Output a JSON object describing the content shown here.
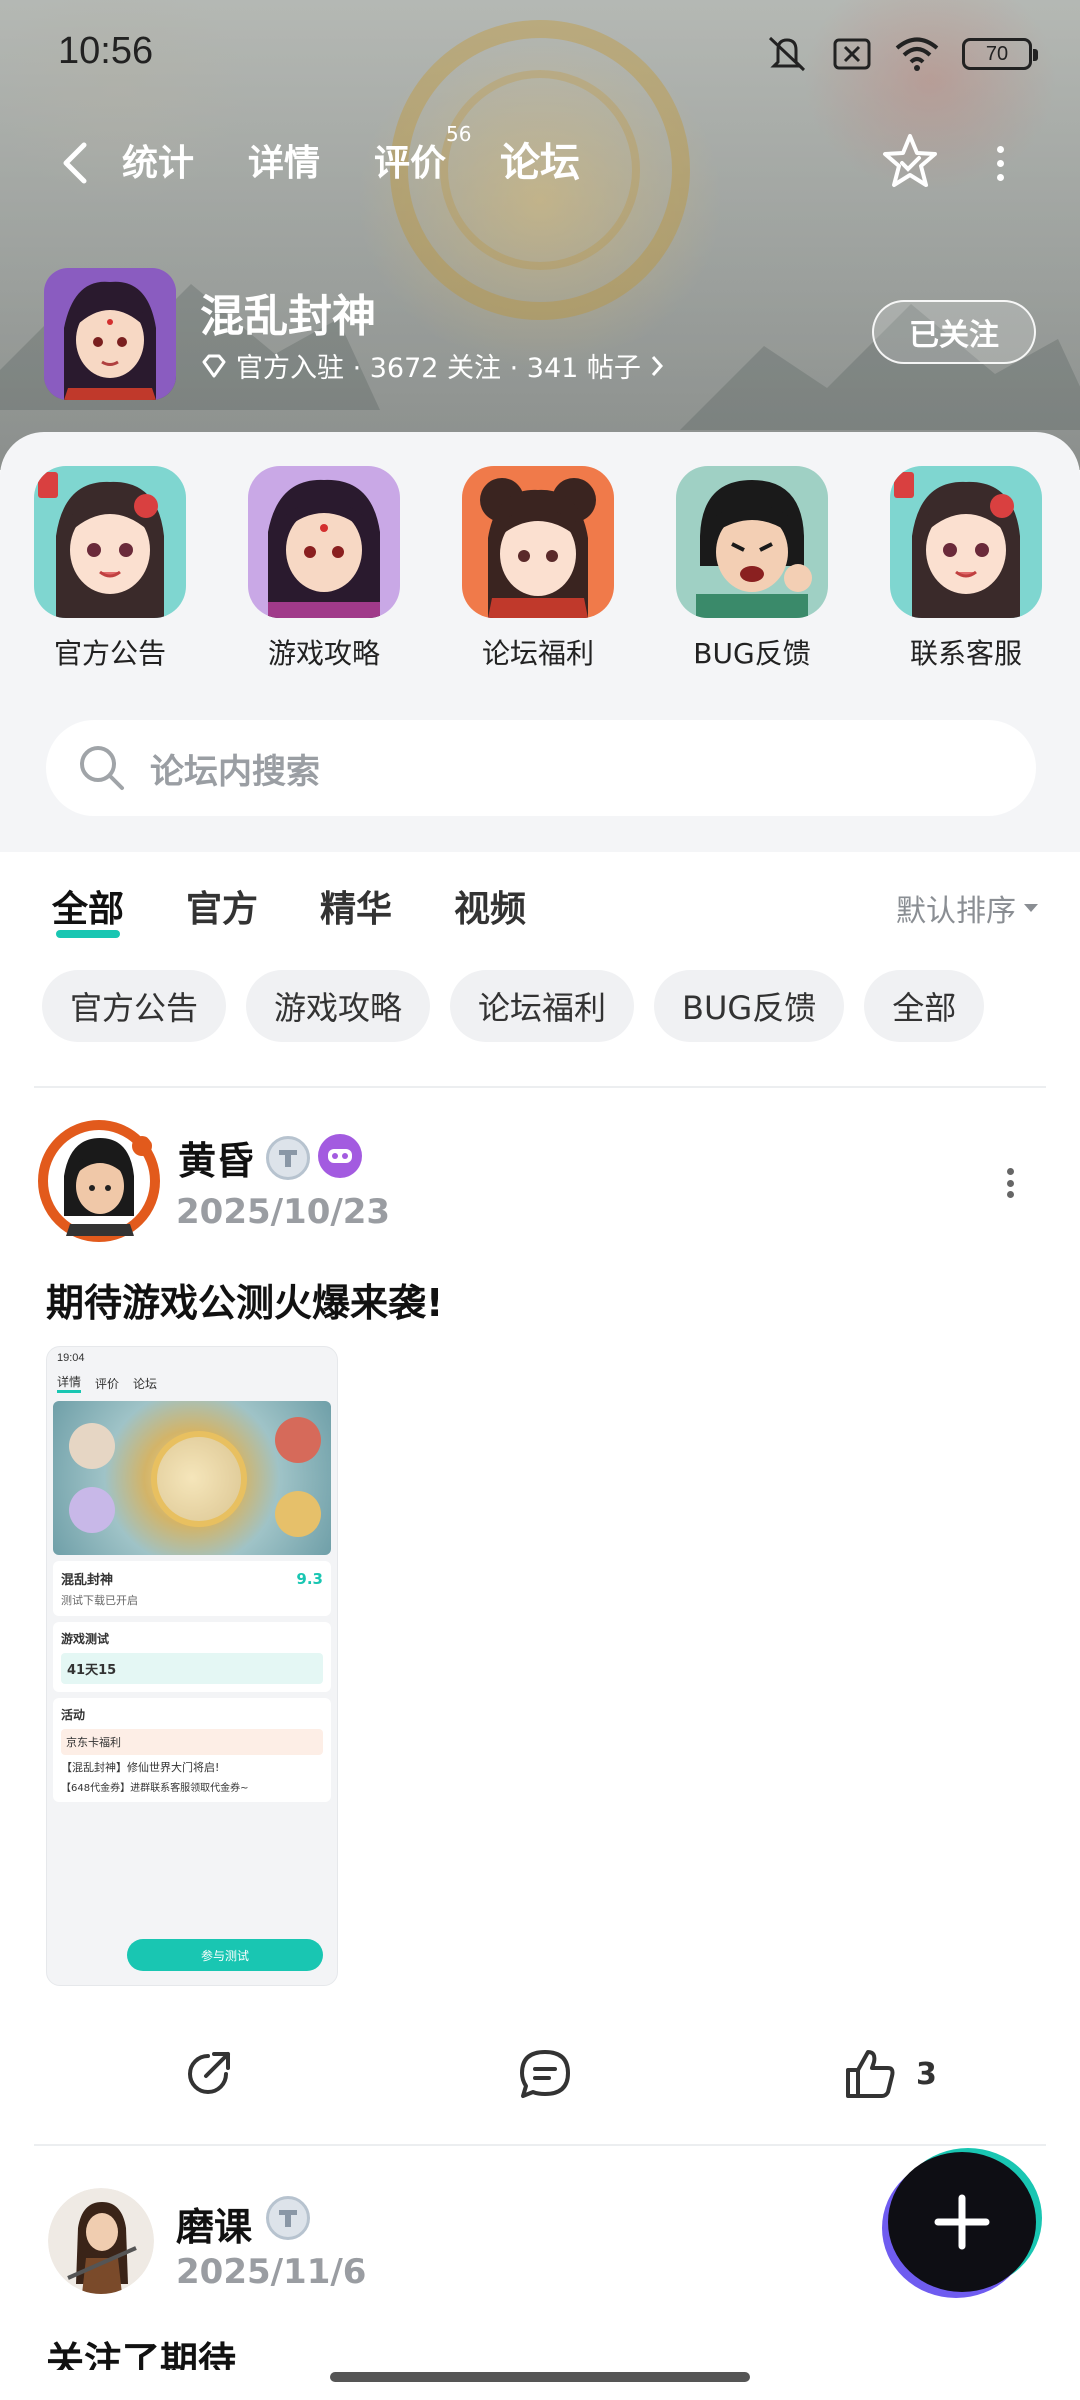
{
  "status_bar": {
    "time": "10:56",
    "battery": "70"
  },
  "nav": {
    "tabs": [
      {
        "label": "统计"
      },
      {
        "label": "详情"
      },
      {
        "label": "评价",
        "count": "56"
      },
      {
        "label": "论坛"
      }
    ],
    "active_tab": "论坛"
  },
  "game": {
    "name": "混乱封神",
    "meta": "官方入驻 · 3672 关注 · 341 帖子",
    "follow_label": "已关注"
  },
  "shortcuts": [
    {
      "label": "官方公告"
    },
    {
      "label": "游戏攻略"
    },
    {
      "label": "论坛福利"
    },
    {
      "label": "BUG反馈"
    },
    {
      "label": "联系客服"
    }
  ],
  "search": {
    "placeholder": "论坛内搜索"
  },
  "feed_tabs": [
    {
      "label": "全部"
    },
    {
      "label": "官方"
    },
    {
      "label": "精华"
    },
    {
      "label": "视频"
    }
  ],
  "sort_label": "默认排序",
  "chips": [
    "官方公告",
    "游戏攻略",
    "论坛福利",
    "BUG反馈",
    "全部"
  ],
  "posts": [
    {
      "author": "黄昏",
      "date": "2025/10/23",
      "title": "期待游戏公测火爆来袭!",
      "likes": "3",
      "screenshot": {
        "time": "19:04",
        "nav_tabs": [
          "详情",
          "评价",
          "论坛"
        ],
        "game_name": "混乱封神",
        "subtitle": "测试下载已开启",
        "score": "9.3",
        "test_title": "游戏测试",
        "countdown": "41天15",
        "section": "活动",
        "item1": "京东卡福利",
        "item2": "【混乱封神】修仙世界大门将启!",
        "item3": "【648代金券】进群联系客服领取代金券~",
        "cta": "参与测试"
      }
    },
    {
      "author": "磨课",
      "date": "2025/11/6",
      "title": "关注了期待"
    }
  ],
  "colors": {
    "accent": "#19c6b2",
    "fab": "#0e0e14"
  }
}
